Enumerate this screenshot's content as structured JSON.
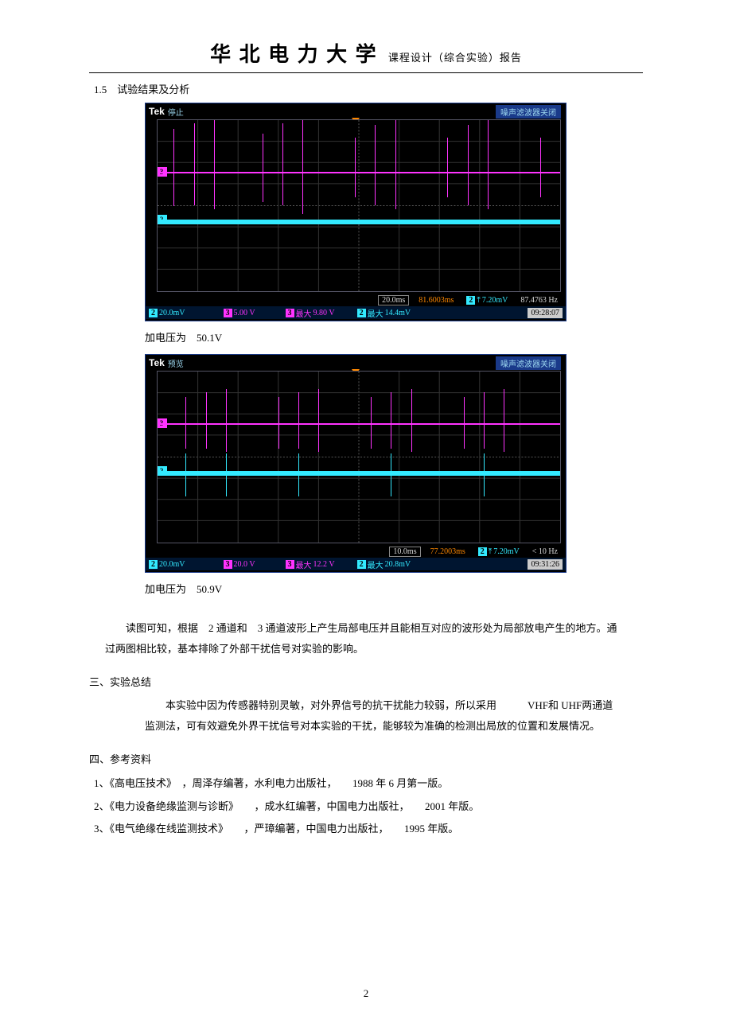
{
  "header": {
    "logo": "华 北 电 力 大 学",
    "subtitle": "课程设计（综合实验）报告"
  },
  "section_1_5": "1.5　试验结果及分析",
  "scope1": {
    "tek": "Tek",
    "status": "停止",
    "filter": "噪声滤波器关闭",
    "timebase": "20.0ms",
    "delay": "81.6003ms",
    "trig_ch": "2",
    "trig_level": "7.20mV",
    "trig_freq": "87.4763 Hz",
    "ch2_scale": "20.0mV",
    "ch3_scale": "5.00 V",
    "ch3_max_label": "最大",
    "ch3_max": "9.80 V",
    "ch2_max_label": "最大",
    "ch2_max": "14.4mV",
    "time": "09:28:07"
  },
  "caption1_prefix": "加电压为　",
  "caption1_value": "50.1V",
  "scope2": {
    "tek": "Tek",
    "status": "预览",
    "filter": "噪声滤波器关闭",
    "timebase": "10.0ms",
    "delay": "77.2003ms",
    "trig_ch": "2",
    "trig_level": "7.20mV",
    "trig_freq": "< 10 Hz",
    "ch2_scale": "20.0mV",
    "ch3_scale": "20.0 V",
    "ch3_max_label": "最大",
    "ch3_max": "12.2 V",
    "ch2_max_label": "最大",
    "ch2_max": "20.8mV",
    "time": "09:31:26"
  },
  "caption2_prefix": "加电压为　",
  "caption2_value": "50.9V",
  "analysis": "读图可知，根据　2 通道和　3 通道波形上产生局部电压并且能相互对应的波形处为局部放电产生的地方。通过两图相比较，基本排除了外部干扰信号对实验的影响。",
  "section3_head": "三、实验总结",
  "section3_body": "本实验中因为传感器特别灵敏，对外界信号的抗干扰能力较弱，所以采用　　　VHF和 UHF两通道监测法，可有效避免外界干扰信号对本实验的干扰，能够较为准确的检测出局放的位置和发展情况。",
  "section4_head": "四、参考资料",
  "refs": [
    "1、《高电压技术》　，周泽存编著，水利电力出版社，　　1988 年 6 月第一版。",
    "2、《电力设备绝缘监测与诊断》　　，成水红编著，中国电力出版社，　　2001 年版。",
    "3、《电气绝缘在线监测技术》　　，严璋编著，中国电力出版社，　　1995 年版。"
  ],
  "page_number": "2",
  "channel_labels": {
    "ch2": "2",
    "ch3": "3",
    "trig_arrow": "⤒"
  }
}
